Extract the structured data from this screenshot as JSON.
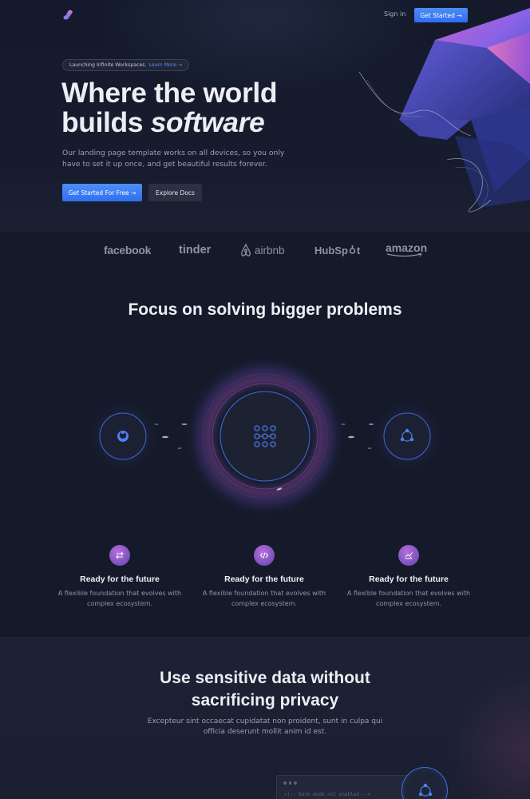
{
  "nav": {
    "signin_label": "Sign in",
    "cta_label": "Get Started →"
  },
  "hero": {
    "announcement": "Launching Infinite Workspaces.",
    "announcement_link": "Learn More →",
    "headline_line1": "Where the world",
    "headline_line2_plain": "builds ",
    "headline_line2_emph": "software",
    "subtext": "Our landing page template works on all devices, so you only have to set it up once, and get beautiful results forever.",
    "primary_button": "Get Started For Free →",
    "secondary_button": "Explore Docs"
  },
  "logos": {
    "facebook": "facebook",
    "tinder": "tinder",
    "airbnb": "airbnb",
    "hubspot_a": "HubSp",
    "hubspot_b": "t",
    "amazon": "amazon"
  },
  "focus": {
    "title": "Focus on solving bigger problems",
    "features": [
      {
        "icon": "arrows-icon",
        "title": "Ready for the future",
        "text": "A flexible foundation that evolves with complex ecosystem."
      },
      {
        "icon": "code-icon",
        "title": "Ready for the future",
        "text": "A flexible foundation that evolves with complex ecosystem."
      },
      {
        "icon": "chart-check-icon",
        "title": "Ready for the future",
        "text": "A flexible foundation that evolves with complex ecosystem."
      }
    ]
  },
  "privacy": {
    "title_line1": "Use sensitive data without",
    "title_line2": "sacrificing privacy",
    "subtext": "Excepteur sint occaecat cupidatat non proident, sunt in culpa qui officia deserunt mollit anim id est.",
    "code_line": "<!-- Dark mode not enabled -->"
  },
  "colors": {
    "background": "#151a2b",
    "accent": "#2f6ff0",
    "feature_icon": "#7a4fbf"
  }
}
